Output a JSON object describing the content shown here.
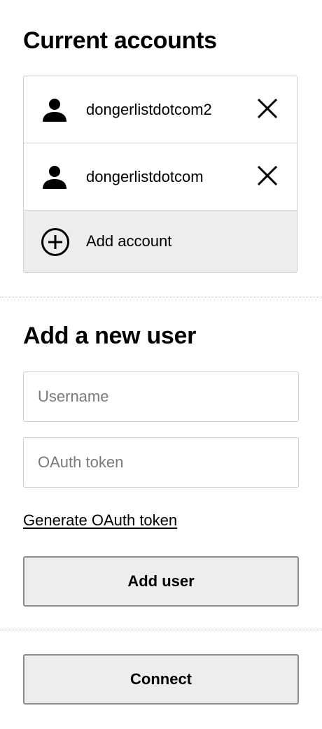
{
  "current_accounts": {
    "title": "Current accounts",
    "accounts": [
      {
        "username": "dongerlistdotcom2",
        "icon": "user-icon",
        "remove_icon": "close-icon"
      },
      {
        "username": "dongerlistdotcom",
        "icon": "user-icon",
        "remove_icon": "close-icon"
      }
    ],
    "add_account": {
      "label": "Add account",
      "icon": "plus-circle-icon"
    }
  },
  "add_user": {
    "title": "Add a new user",
    "username_field": {
      "value": "",
      "placeholder": "Username"
    },
    "token_field": {
      "value": "",
      "placeholder": "OAuth token"
    },
    "generate_link": "Generate OAuth token",
    "submit_label": "Add user"
  },
  "connect": {
    "label": "Connect"
  },
  "colors": {
    "button_background": "#ededed",
    "button_border": "#8c8c8c",
    "field_border": "#cfcfcf",
    "placeholder": "#7a7a7a"
  }
}
